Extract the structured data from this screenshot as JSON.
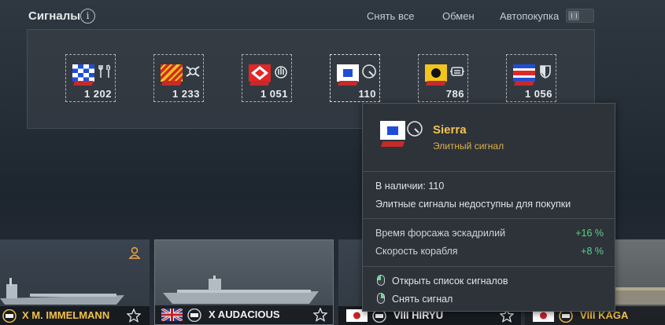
{
  "header": {
    "title": "Сигналы",
    "info_icon": "i",
    "remove_all": "Снять все",
    "exchange": "Обмен",
    "autobuy": "Автопокупка"
  },
  "signals": [
    {
      "count": "1 202",
      "flag": "blue-white-checker",
      "icon": "wrench-icon"
    },
    {
      "count": "1 233",
      "flag": "yellow-red-diagonal",
      "icon": "crossed-guns-icon"
    },
    {
      "count": "1 051",
      "flag": "red-white-diamond",
      "icon": "fire-extinguisher-icon"
    },
    {
      "count": "110",
      "flag": "blue-white-square",
      "icon": "speedometer-icon"
    },
    {
      "count": "786",
      "flag": "yellow-black-disc",
      "icon": "engine-icon"
    },
    {
      "count": "1 056",
      "flag": "blue-red-stripes",
      "icon": "shield-icon"
    }
  ],
  "tooltip": {
    "name": "Sierra",
    "type": "Элитный сигнал",
    "stock_label": "В наличии:",
    "stock_value": "110",
    "note": "Элитные сигналы недоступны для покупки",
    "modifiers": [
      {
        "label": "Время форсажа эскадрилий",
        "value": "+16 %"
      },
      {
        "label": "Скорость корабля",
        "value": "+8 %"
      }
    ],
    "actions": [
      {
        "label": "Открыть список сигналов",
        "mouse": "left"
      },
      {
        "label": "Снять сигнал",
        "mouse": "right"
      }
    ]
  },
  "ships": [
    {
      "name": "X M. IMMELMANN",
      "nation": "germany",
      "gold": true
    },
    {
      "name": "X AUDACIOUS",
      "nation": "uk",
      "gold": false
    },
    {
      "name": "VIII HIRYU",
      "nation": "japan",
      "gold": false
    },
    {
      "name": "VIII KAGA",
      "nation": "japan",
      "gold": true
    }
  ],
  "colors": {
    "accent_gold": "#f5c252",
    "bonus_green": "#5fd18a",
    "background": "#252d36"
  }
}
